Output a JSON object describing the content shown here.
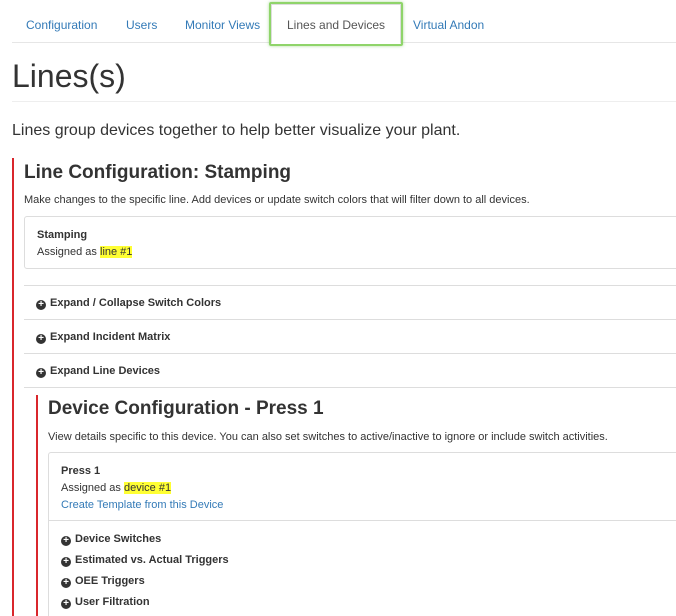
{
  "nav": {
    "tabs": [
      {
        "label": "Configuration"
      },
      {
        "label": "Users"
      },
      {
        "label": "Monitor Views"
      },
      {
        "label": "Lines and Devices"
      },
      {
        "label": "Virtual Andon"
      }
    ],
    "active": "Lines and Devices"
  },
  "page": {
    "title": "Lines(s)",
    "intro": "Lines group devices together to help better visualize your plant."
  },
  "line": {
    "title": "Line Configuration: Stamping",
    "description": "Make changes to the specific line. Add devices or update switch colors that will filter down to all devices.",
    "name": "Stamping",
    "assigned_prefix": "Assigned as",
    "assigned_value": "line #1",
    "expanders": [
      {
        "label": "Expand / Collapse Switch Colors"
      },
      {
        "label": "Expand Incident Matrix"
      },
      {
        "label": "Expand Line Devices"
      }
    ]
  },
  "device": {
    "title": "Device Configuration - Press 1",
    "description": "View details specific to this device. You can also set switches to active/inactive to ignore or include switch activities.",
    "name": "Press 1",
    "assigned_prefix": "Assigned as",
    "assigned_value": "device #1",
    "template_link": "Create Template from this Device",
    "sections": [
      {
        "label": "Device Switches"
      },
      {
        "label": "Estimated vs. Actual Triggers"
      },
      {
        "label": "OEE Triggers"
      },
      {
        "label": "User Filtration"
      }
    ]
  },
  "icons": {
    "expand": "plus-circle-icon"
  },
  "colors": {
    "link": "#337ab7",
    "accent_bar": "#d9262c",
    "highlight": "#ffff33",
    "tab_focus": "#8fd46a"
  }
}
